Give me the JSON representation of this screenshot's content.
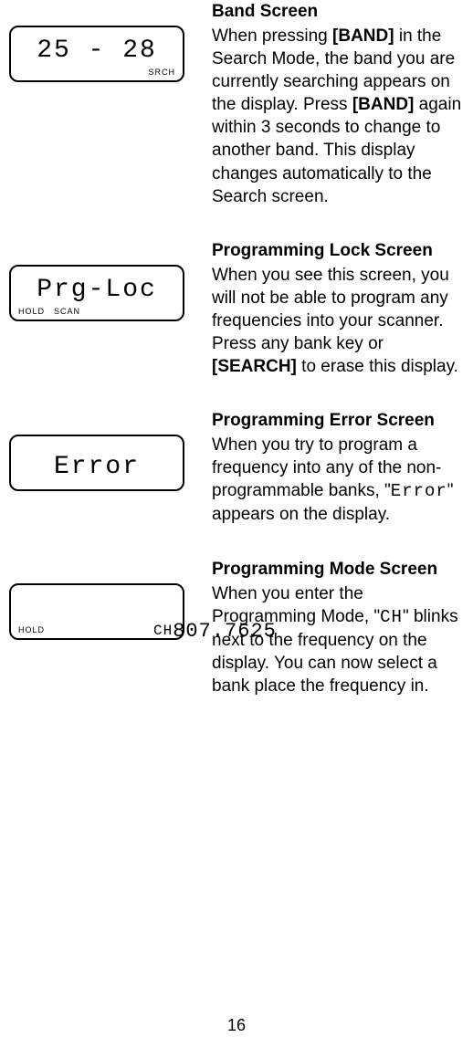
{
  "page_number": "16",
  "sections": [
    {
      "title": "Band Screen",
      "body_parts": [
        "When pressing ",
        "[BAND]",
        " in the Search Mode, the band you are currently searching appears on the display. Press ",
        "[BAND]",
        " again within 3 seconds to change to another band. This display changes automatically to the Search screen."
      ],
      "body_bold_map": [
        false,
        true,
        false,
        true,
        false
      ],
      "lcd_main": "25 - 28",
      "lcd_left_indicators": [],
      "lcd_right_indicator": "SRCH"
    },
    {
      "title": "Programming Lock Screen",
      "body_parts": [
        "When you see this screen, you will not be able to program any frequencies into your scanner. Press any bank key or ",
        "[SEARCH]",
        " to erase this display."
      ],
      "body_bold_map": [
        false,
        true,
        false
      ],
      "lcd_main": "Prg-Loc",
      "lcd_left_indicators": [
        "HOLD",
        "SCAN"
      ],
      "lcd_right_indicator": ""
    },
    {
      "title": "Programming Error Screen",
      "body_parts": [
        "When you try to program a frequency into any of the non-programmable banks, \"",
        "Error",
        "\" appears on the display."
      ],
      "body_bold_map": [
        false,
        false,
        false
      ],
      "body_seg_map": [
        false,
        true,
        false
      ],
      "lcd_main": "Error",
      "lcd_left_indicators": [],
      "lcd_right_indicator": ""
    },
    {
      "title": "Programming Mode Screen",
      "body_parts": [
        "When you enter the Programming Mode, \"",
        "CH",
        "\" blinks next to the frequency on the display. You can now select a bank place the frequency in."
      ],
      "body_bold_map": [
        false,
        false,
        false
      ],
      "body_seg_map": [
        false,
        true,
        false
      ],
      "lcd_main_prefix": "CH",
      "lcd_main": "807.7625",
      "lcd_left_indicators": [
        "HOLD"
      ],
      "lcd_right_indicator": ""
    }
  ]
}
